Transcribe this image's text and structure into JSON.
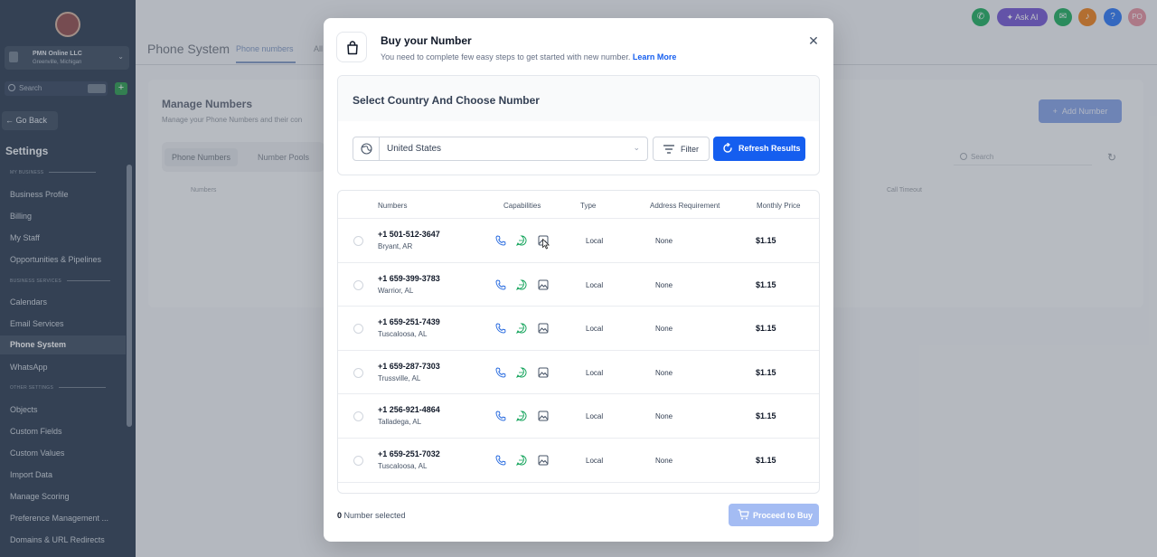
{
  "sidebar": {
    "account_name": "PMN Online LLC",
    "account_sub": "Greenville, Michigan",
    "search_placeholder": "Search",
    "go_back": "← Go Back",
    "settings_title": "Settings",
    "sections": {
      "my_business": "MY BUSINESS",
      "business_services": "BUSINESS SERVICES",
      "other_settings": "OTHER SETTINGS"
    },
    "items": [
      {
        "label": "Business Profile"
      },
      {
        "label": "Billing"
      },
      {
        "label": "My Staff"
      },
      {
        "label": "Opportunities & Pipelines"
      },
      {
        "label": "Calendars"
      },
      {
        "label": "Email Services"
      },
      {
        "label": "Phone System",
        "active": true
      },
      {
        "label": "WhatsApp"
      },
      {
        "label": "Objects"
      },
      {
        "label": "Custom Fields"
      },
      {
        "label": "Custom Values"
      },
      {
        "label": "Import Data"
      },
      {
        "label": "Manage Scoring"
      },
      {
        "label": "Preference Management ..."
      },
      {
        "label": "Domains & URL Redirects"
      }
    ]
  },
  "page": {
    "title": "Phone System",
    "tab_active": "Phone numbers",
    "tab_next": "All",
    "manage_title": "Manage Numbers",
    "manage_sub": "Manage your Phone Numbers and their con",
    "add_number": "Add Number",
    "pill_tabs": [
      "Phone Numbers",
      "Number Pools"
    ],
    "bg_col_numbers": "Numbers",
    "bg_col_call_timeout": "Call Timeout",
    "search_placeholder": "Search"
  },
  "topbar": {
    "ask_ai": "Ask AI",
    "user_initials": "PO"
  },
  "modal": {
    "title": "Buy your Number",
    "subtitle": "You need to complete few easy steps to get started with new number.",
    "learn_more": "Learn More",
    "select_title": "Select Country And Choose Number",
    "country": "United States",
    "filter_label": "Filter",
    "refresh_label": "Refresh Results",
    "columns": {
      "numbers": "Numbers",
      "capabilities": "Capabilities",
      "type": "Type",
      "address": "Address Requirement",
      "price": "Monthly Price"
    },
    "rows": [
      {
        "number": "+1 501-512-3647",
        "location": "Bryant, AR",
        "type": "Local",
        "address": "None",
        "price": "$1.15"
      },
      {
        "number": "+1 659-399-3783",
        "location": "Warrior, AL",
        "type": "Local",
        "address": "None",
        "price": "$1.15"
      },
      {
        "number": "+1 659-251-7439",
        "location": "Tuscaloosa, AL",
        "type": "Local",
        "address": "None",
        "price": "$1.15"
      },
      {
        "number": "+1 659-287-7303",
        "location": "Trussville, AL",
        "type": "Local",
        "address": "None",
        "price": "$1.15"
      },
      {
        "number": "+1 256-921-4864",
        "location": "Talladega, AL",
        "type": "Local",
        "address": "None",
        "price": "$1.15"
      },
      {
        "number": "+1 659-251-7032",
        "location": "Tuscaloosa, AL",
        "type": "Local",
        "address": "None",
        "price": "$1.15"
      }
    ],
    "selected_count": "0",
    "selected_label": "Number selected",
    "proceed_label": "Proceed to Buy"
  },
  "colors": {
    "primary": "#155eef",
    "phone_icon": "#2e6fe0",
    "sms_icon": "#12a35a",
    "mms_icon": "#475467"
  }
}
